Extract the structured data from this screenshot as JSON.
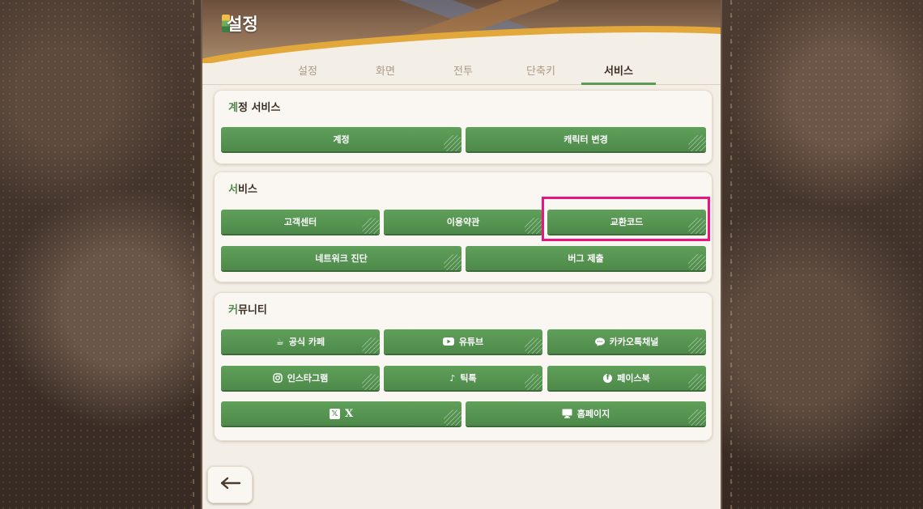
{
  "header": {
    "title": "설정"
  },
  "tabs": [
    {
      "label": "설정"
    },
    {
      "label": "화면"
    },
    {
      "label": "전투"
    },
    {
      "label": "단축키"
    },
    {
      "label": "서비스",
      "active": true
    }
  ],
  "sections": {
    "account": {
      "title_first": "계",
      "title_rest": "정 서비스",
      "buttons": {
        "account": "계정",
        "change_character": "캐릭터 변경"
      }
    },
    "service": {
      "title_first": "서",
      "title_rest": "비스",
      "buttons": {
        "support": "고객센터",
        "terms": "이용약관",
        "coupon": "교환코드",
        "network": "네트워크 진단",
        "bug": "버그 제출"
      }
    },
    "community": {
      "title_first": "커",
      "title_rest": "뮤니티",
      "buttons": {
        "cafe": "공식 카페",
        "youtube": "유튜브",
        "kakao": "카카오톡채널",
        "instagram": "인스타그램",
        "tiktok": "틱톡",
        "facebook": "페이스북",
        "x": "X",
        "homepage": "홈페이지"
      }
    }
  },
  "icons": {
    "cafe": "coffee-cup-icon",
    "youtube": "youtube-icon",
    "kakao": "kakao-chat-icon",
    "instagram": "instagram-icon",
    "tiktok": "tiktok-icon",
    "facebook": "facebook-icon",
    "x": "x-logo-icon",
    "homepage": "monitor-icon",
    "back": "back-arrow-icon"
  },
  "colors": {
    "button_green": "#5fa05a",
    "active_tab_underline": "#5a9a55",
    "highlight": "#e8167e",
    "panel_bg": "#f4efe6"
  }
}
